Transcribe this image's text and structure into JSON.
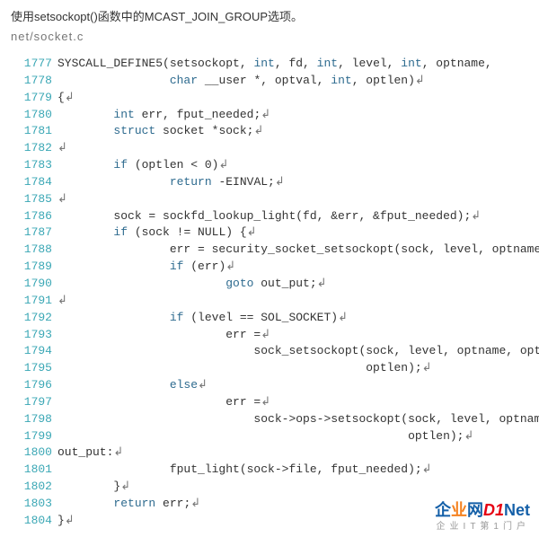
{
  "intro": "使用setsockopt()函数中的MCAST_JOIN_GROUP选项。",
  "filepath": "net/socket.c",
  "code": [
    {
      "n": "1777",
      "html": "SYSCALL_DEFINE5(setsockopt, <span class='kw'>int</span>, fd, <span class='kw'>int</span>, level, <span class='kw'>int</span>, optname,"
    },
    {
      "n": "1778",
      "html": "                <span class='kw'>char</span> __user *, optval, <span class='kw'>int</span>, optlen)<span class='marker'>↲</span>"
    },
    {
      "n": "1779",
      "html": "{<span class='marker'>↲</span>"
    },
    {
      "n": "1780",
      "html": "        <span class='kw'>int</span> err, fput_needed;<span class='marker'>↲</span>"
    },
    {
      "n": "1781",
      "html": "        <span class='kw'>struct</span> socket *sock;<span class='marker'>↲</span>"
    },
    {
      "n": "1782",
      "html": "<span class='marker'>↲</span>"
    },
    {
      "n": "1783",
      "html": "        <span class='kw'>if</span> (optlen &lt; 0)<span class='marker'>↲</span>"
    },
    {
      "n": "1784",
      "html": "                <span class='kw'>return</span> -EINVAL;<span class='marker'>↲</span>"
    },
    {
      "n": "1785",
      "html": "<span class='marker'>↲</span>"
    },
    {
      "n": "1786",
      "html": "        sock = sockfd_lookup_light(fd, &amp;err, &amp;fput_needed);<span class='marker'>↲</span>"
    },
    {
      "n": "1787",
      "html": "        <span class='kw'>if</span> (sock != NULL) {<span class='marker'>↲</span>"
    },
    {
      "n": "1788",
      "html": "                err = security_socket_setsockopt(sock, level, optname);<span class='marker'>↲</span>"
    },
    {
      "n": "1789",
      "html": "                <span class='kw'>if</span> (err)<span class='marker'>↲</span>"
    },
    {
      "n": "1790",
      "html": "                        <span class='goto'>goto</span> out_put;<span class='marker'>↲</span>"
    },
    {
      "n": "1791",
      "html": "<span class='marker'>↲</span>"
    },
    {
      "n": "1792",
      "html": "                <span class='kw'>if</span> (level == SOL_SOCKET)<span class='marker'>↲</span>"
    },
    {
      "n": "1793",
      "html": "                        err =<span class='marker'>↲</span>"
    },
    {
      "n": "1794",
      "html": "                            sock_setsockopt(sock, level, optname, optval,<span class='marker'>↲</span>"
    },
    {
      "n": "1795",
      "html": "                                            optlen);<span class='marker'>↲</span>"
    },
    {
      "n": "1796",
      "html": "                <span class='kw'>else</span><span class='marker'>↲</span>"
    },
    {
      "n": "1797",
      "html": "                        err =<span class='marker'>↲</span>"
    },
    {
      "n": "1798",
      "html": "                            sock-&gt;ops-&gt;setsockopt(sock, level, optname, optval,<span class='marker'>↲</span>"
    },
    {
      "n": "1799",
      "html": "                                                  optlen);<span class='marker'>↲</span>"
    },
    {
      "n": "1800",
      "html": "out_put:<span class='marker'>↲</span>"
    },
    {
      "n": "1801",
      "html": "                fput_light(sock-&gt;file, fput_needed);<span class='marker'>↲</span>"
    },
    {
      "n": "1802",
      "html": "        }<span class='marker'>↲</span>"
    },
    {
      "n": "1803",
      "html": "        <span class='kw'>return</span> err;<span class='marker'>↲</span>"
    },
    {
      "n": "1804",
      "html": "}<span class='marker'>↲</span>"
    }
  ],
  "watermark": {
    "qi": "企",
    "ye": "业",
    "wang": "网",
    "d1": "D1",
    "net": "Net",
    "subtitle": "企业IT第1门户"
  }
}
